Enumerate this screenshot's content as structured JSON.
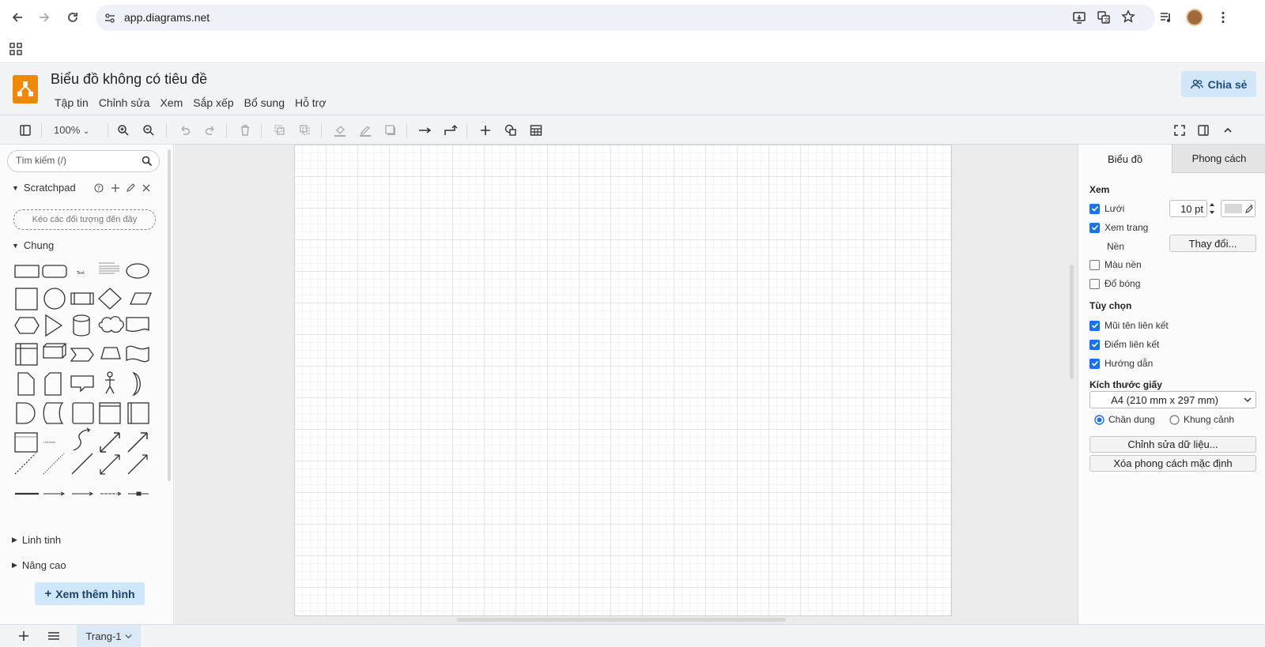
{
  "browser": {
    "url": "app.diagrams.net"
  },
  "app": {
    "title": "Biểu đồ không có tiêu đề",
    "menu": [
      "Tập tin",
      "Chỉnh sửa",
      "Xem",
      "Sắp xếp",
      "Bổ sung",
      "Hỗ trợ"
    ],
    "share_label": "Chia sẻ",
    "accent_color": "#f08705"
  },
  "toolbar": {
    "zoom": "100%"
  },
  "left_panel": {
    "search_placeholder": "Tìm kiếm (/)",
    "scratchpad_title": "Scratchpad",
    "scratchpad_drop": "Kéo các đối tượng đến đây",
    "general_title": "Chung",
    "misc_title": "Linh tinh",
    "advanced_title": "Nâng cao",
    "more_shapes": "Xem thêm hình"
  },
  "right_panel": {
    "tab_diagram": "Biểu đồ",
    "tab_style": "Phong cách",
    "view_title": "Xem",
    "grid_label": "Lưới",
    "grid_size": "10 pt",
    "page_view_label": "Xem trang",
    "background_label": "Nền",
    "change_btn": "Thay đổi...",
    "bg_color_label": "Màu nền",
    "shadow_label": "Đổ bóng",
    "options_title": "Tùy chọn",
    "connection_arrows": "Mũi tên liên kết",
    "connection_points": "Điểm liên kết",
    "guides": "Hướng dẫn",
    "paper_size_title": "Kích thước giấy",
    "paper_size": "A4 (210 mm x 297 mm)",
    "portrait": "Chân dung",
    "landscape": "Khung cảnh",
    "edit_data_btn": "Chỉnh sửa dữ liệu...",
    "clear_style_btn": "Xóa phong cách mặc định"
  },
  "bottom_bar": {
    "page_tab": "Trang-1"
  }
}
